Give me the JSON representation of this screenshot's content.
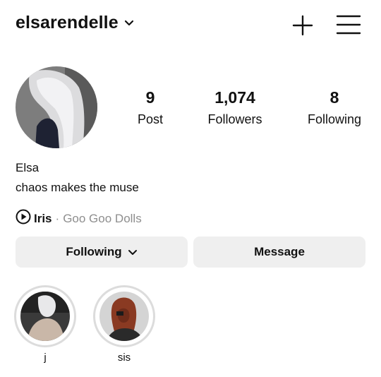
{
  "header": {
    "username": "elsarendelle",
    "icons": {
      "dropdown": "chevron-down-icon",
      "create": "plus-icon",
      "menu": "hamburger-menu-icon"
    }
  },
  "profile": {
    "avatar_icon": "profile-photo"
  },
  "stats": {
    "posts": {
      "value": "9",
      "label": "Post"
    },
    "followers": {
      "value": "1,074",
      "label": "Followers"
    },
    "following": {
      "value": "8",
      "label": "Following"
    }
  },
  "bio": {
    "name": "Elsa",
    "text": "chaos makes the muse"
  },
  "music": {
    "icon": "play-circle-icon",
    "song": "Iris",
    "separator": "·",
    "artist": "Goo Goo Dolls"
  },
  "actions": {
    "following_label": "Following",
    "message_label": "Message"
  },
  "highlights": [
    {
      "label": "j"
    },
    {
      "label": "sis"
    }
  ],
  "colors": {
    "text": "#111111",
    "secondary_text": "#8e8e8e",
    "button_bg": "#efefef",
    "highlight_ring": "#dcdcdc"
  }
}
